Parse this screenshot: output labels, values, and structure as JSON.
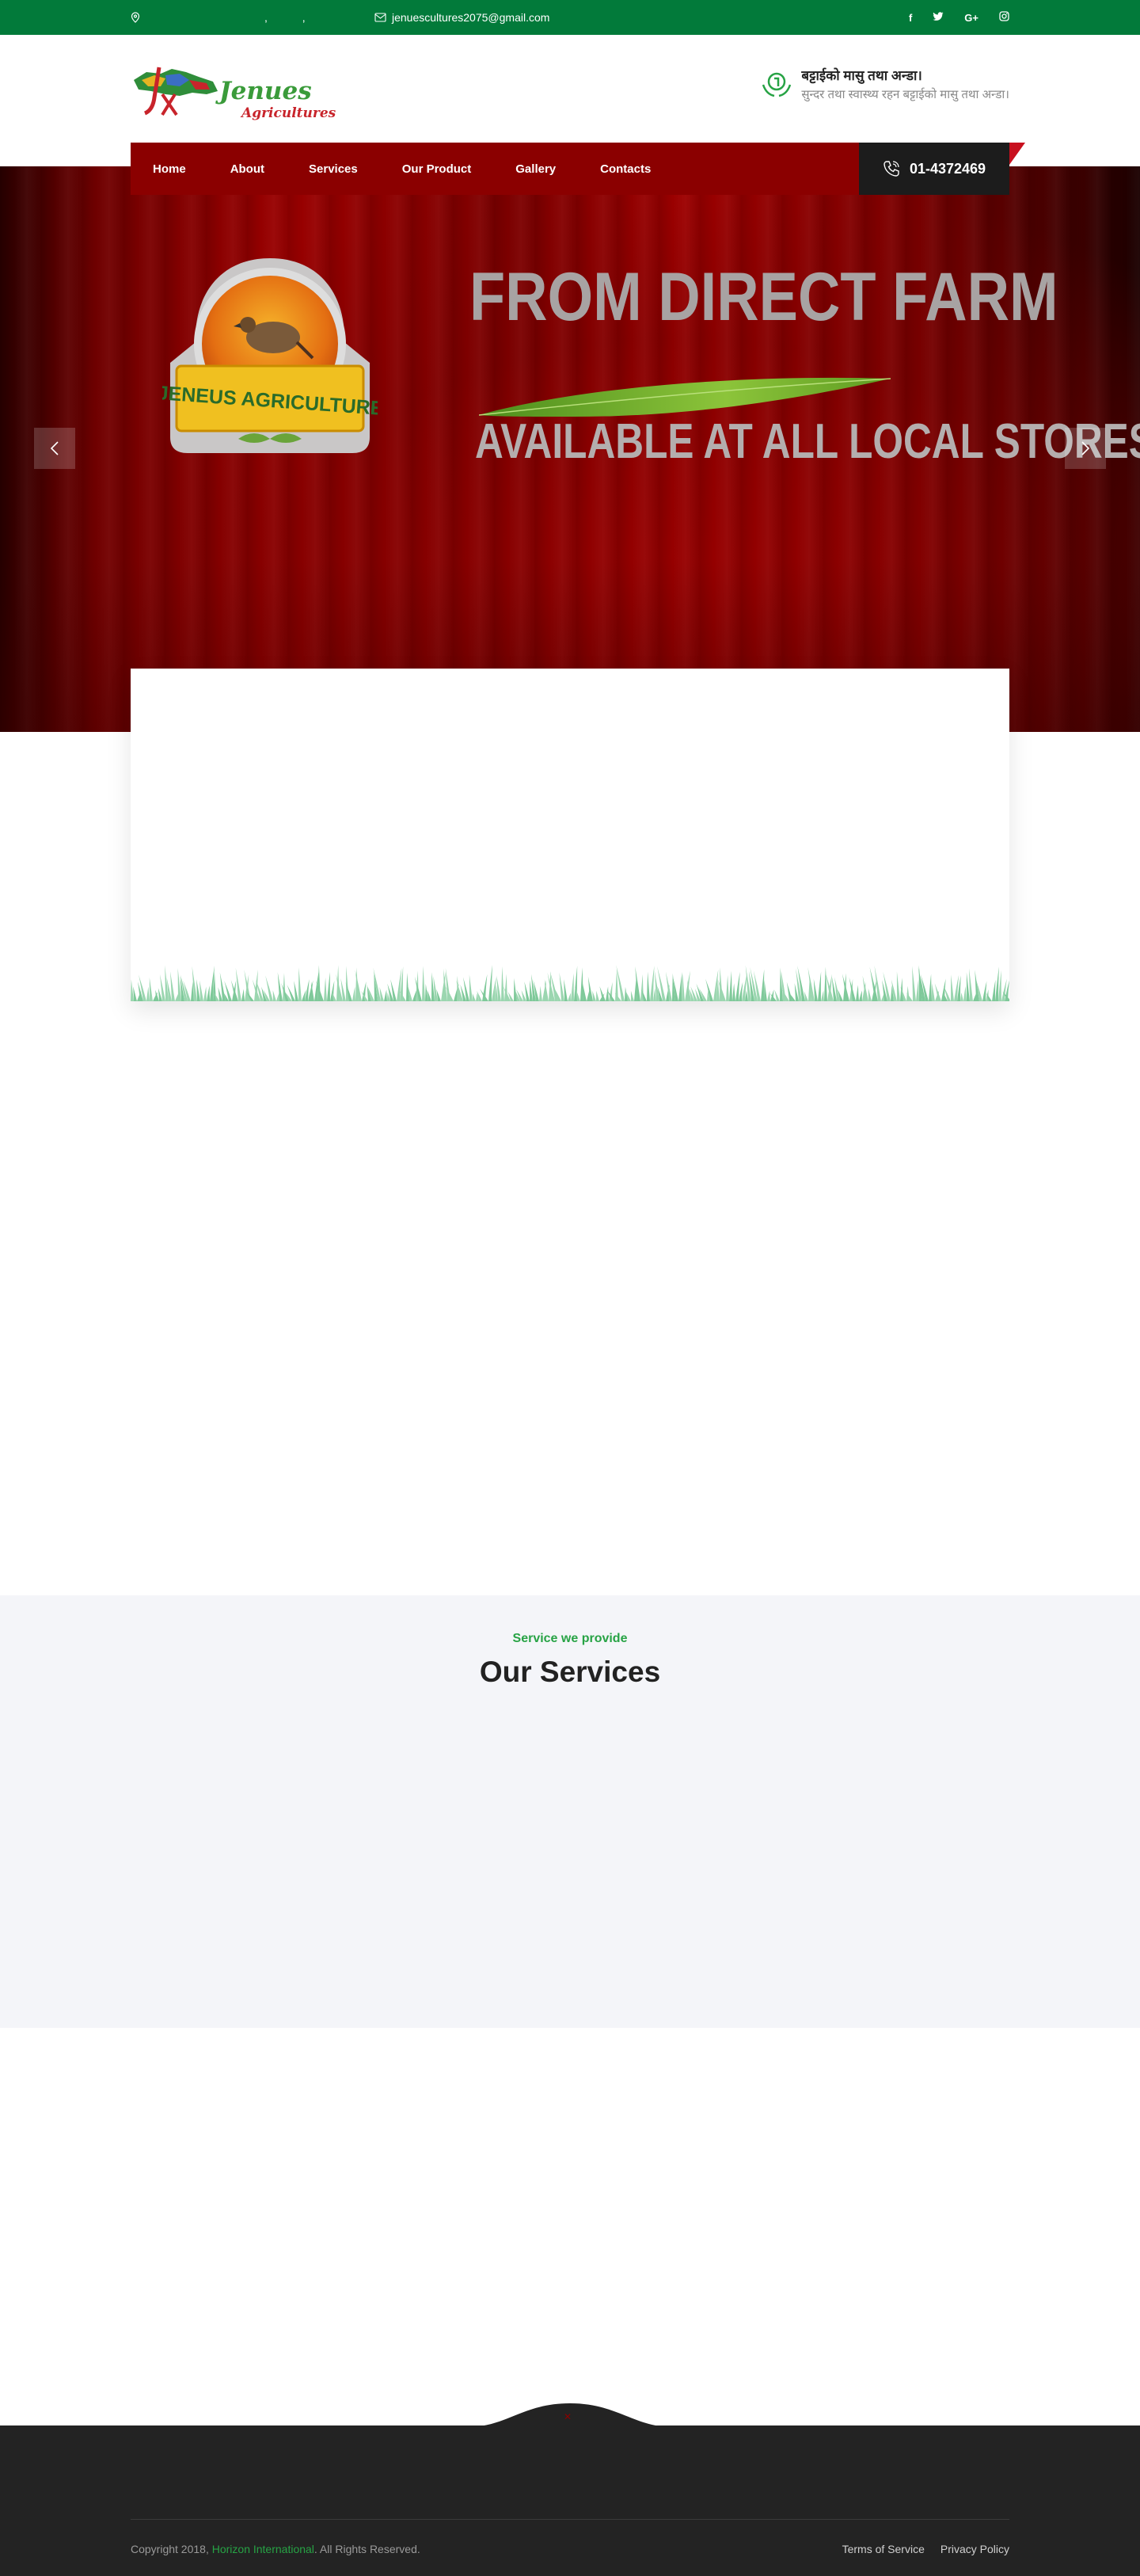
{
  "topbar": {
    "location_text": ", ,",
    "email": "jenuescultures2075@gmail.com",
    "social": [
      "f",
      "t",
      "G+",
      "ig"
    ]
  },
  "header": {
    "logo_title": "Jenues",
    "logo_subtitle": "Agricultures",
    "info_title": "बट्टाईको मासु तथा अन्डा।",
    "info_subtitle": "सुन्दर तथा स्वास्थ्य रहन बट्टाईको मासु तथा अन्डा।"
  },
  "nav": {
    "items": [
      "Home",
      "About",
      "Services",
      "Our Product",
      "Gallery",
      "Contacts"
    ],
    "phone": "01-4372469"
  },
  "hero": {
    "badge_text": "JENEUS AGRICULTURE",
    "line1": "FROM DIRECT FARM",
    "line2": "AVAILABLE AT ALL LOCAL STORES"
  },
  "services": {
    "tagline": "Service we provide",
    "title": "Our Services"
  },
  "footer": {
    "copy_prefix": "Copyright 2018, ",
    "copy_link": "Horizon International",
    "copy_suffix": ". All Rights Reserved.",
    "links": [
      "Terms of Service",
      "Privacy Policy"
    ]
  },
  "colors": {
    "topbar": "#027a3a",
    "nav": "#8b0000",
    "accent_green": "#27a345",
    "footer": "#232323"
  }
}
